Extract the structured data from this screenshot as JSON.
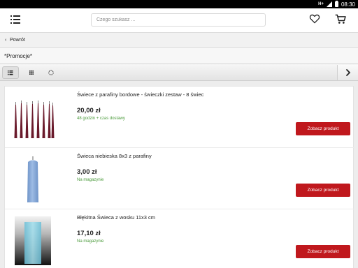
{
  "status_bar": {
    "network": "H+",
    "time": "08:30"
  },
  "header": {
    "search_placeholder": "Czego szukasz ..."
  },
  "back": {
    "label": "Powrót"
  },
  "page": {
    "title": "*Promocje*"
  },
  "products": [
    {
      "name": "Świece z parafiny bordowe - świeczki zestaw - 8 świec",
      "price": "20,00 zł",
      "availability": "48 godzin + czas dostawy",
      "button": "Zobacz produkt"
    },
    {
      "name": "Świeca niebieska 8x3 z parafiny",
      "price": "3,00 zł",
      "availability": "Na magazynie",
      "button": "Zobacz produkt"
    },
    {
      "name": "Błękitna Świeca z wosku 11x3 cm",
      "price": "17,10 zł",
      "availability": "Na magazynie",
      "button": "Zobacz produkt"
    }
  ],
  "colors": {
    "accent": "#c0181d",
    "availability": "#4a9a3a",
    "candle_bordeaux": "#6a1a2b",
    "candle_blue": "#86a9d8",
    "candle_light_blue": "#8ad0e4"
  }
}
